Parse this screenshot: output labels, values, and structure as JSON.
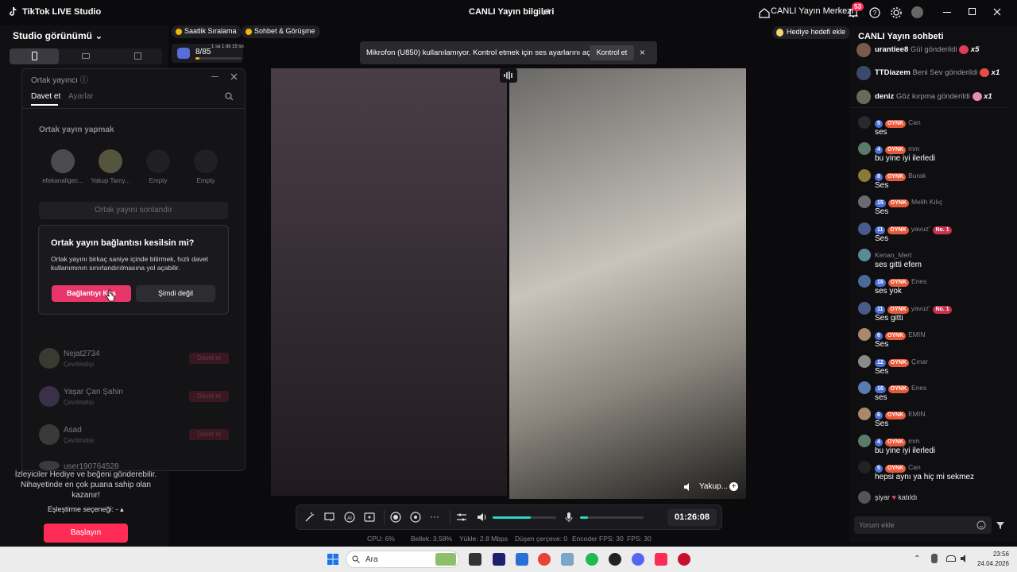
{
  "app": {
    "title": "TikTok LIVE Studio",
    "center_title": "CANLI Yayın bilgileri",
    "live_center": "CANLI Yayın Merkezi",
    "notification_count": "53"
  },
  "left": {
    "studio_view": "Studio görünümü",
    "bottom_text": "İzleyiciler Hediye ve beğeni gönderebilir. Nihayetinde en çok puana sahip olan kazanır!",
    "match_option": "Eşleştirme seçeneği: -",
    "start_button": "Başlayın"
  },
  "chips": {
    "hourly_rank": "Saatlik Sıralama",
    "chat_meet": "Sohbet & Görüşme",
    "progress_text": "8/85",
    "progress_small": "1 sa 1 dk 15 sn",
    "progress_fraction": 0.09,
    "gift_goal": "Hediye hedefi ekle"
  },
  "cohost": {
    "title": "Ortak yayıncı",
    "tab_invite": "Davet et",
    "tab_settings": "Ayarlar",
    "section": "Ortak yayın yapmak",
    "slots": [
      {
        "label": "efekanaligec..."
      },
      {
        "label": "Yakup Tamy..."
      },
      {
        "label": "Empty"
      },
      {
        "label": "Empty"
      }
    ],
    "end_button": "Ortak yayını sonlandır",
    "rows": [
      {
        "name": "Nejat2734",
        "status": "Çevrimdışı",
        "invite": "Davet et"
      },
      {
        "name": "Yaşar Çan Şahin",
        "status": "Çevrimdışı",
        "invite": "Davet et"
      },
      {
        "name": "Asad",
        "status": "Çevrimdışı",
        "invite": "Davet et"
      },
      {
        "name": "user190764528",
        "status": "",
        "invite": ""
      }
    ]
  },
  "dialog": {
    "title": "Ortak yayın bağlantısı kesilsin mi?",
    "body": "Ortak yayını birkaç saniye içinde bitirmek, hızlı davet kullanımının sınırlandırılmasına yol açabilir.",
    "primary": "Bağlantıyı Kes",
    "secondary": "Şimdi değil"
  },
  "notice": {
    "text": "Mikrofon (U850) kullanılamıyor. Kontrol etmek için ses ayarlarını açın.",
    "button": "Kontrol et"
  },
  "video": {
    "cohost_name": "Yakup..."
  },
  "toolbar": {
    "timer": "01:26:08",
    "volume_level": 0.6,
    "mic_level": 0.12
  },
  "stats": {
    "cpu": "CPU: 6%",
    "memory": "Bellek: 3.58%",
    "upload": "Yükle: 2.8 Mbps",
    "dropped": "Düşen çerçeve: 0",
    "encoder_fps": "Encoder FPS: 30",
    "fps": "FPS: 30"
  },
  "chat": {
    "title": "CANLI Yayın sohbeti",
    "gifts": [
      {
        "name": "urantiee8",
        "action": "Gül gönderildi",
        "count": "x5"
      },
      {
        "name": "TTDiazem",
        "action": "Beni Sev gönderildi",
        "count": "x1"
      },
      {
        "name": "deniz",
        "action": "Göz kırpma gönderildi",
        "count": "x1"
      }
    ],
    "messages": [
      {
        "level": "5",
        "user": "Can",
        "text": "ses",
        "no1": false
      },
      {
        "level": "4",
        "user": "mm",
        "text": "bu yine iyi ilerledi",
        "no1": false
      },
      {
        "level": "8",
        "user": "Burak",
        "text": "Ses",
        "no1": false
      },
      {
        "level": "15",
        "user": "Melih Kılıç",
        "text": "Ses",
        "no1": false
      },
      {
        "level": "11",
        "user": "yavuz'",
        "text": "Ses",
        "no1": true
      },
      {
        "level": "",
        "user": "Kenan_Mert",
        "text": "ses gitti efem",
        "no1": false
      },
      {
        "level": "16",
        "user": "Enes",
        "text": "ses yok",
        "no1": false
      },
      {
        "level": "11",
        "user": "yavuz'",
        "text": "Ses gitti",
        "no1": true
      },
      {
        "level": "6",
        "user": "EMIN",
        "text": "Ses",
        "no1": false
      },
      {
        "level": "12",
        "user": "Çınar",
        "text": "Ses",
        "no1": false
      },
      {
        "level": "16",
        "user": "Enes",
        "text": "ses",
        "no1": false
      },
      {
        "level": "6",
        "user": "EMIN",
        "text": "Ses",
        "no1": false
      },
      {
        "level": "4",
        "user": "mm",
        "text": "bu yine iyi ilerledi",
        "no1": false
      },
      {
        "level": "5",
        "user": "Can",
        "text": "hepsi aynı ya hiç mi sekmez",
        "no1": false
      }
    ],
    "oynk_label": "OYNK",
    "no1_label": "No. 1",
    "join_user": "şiyar",
    "join_text": "katıldı",
    "comment_placeholder": "Yorum ekle"
  },
  "taskbar": {
    "search": "Ara",
    "time": "23:56",
    "date": "24.04.2026"
  }
}
